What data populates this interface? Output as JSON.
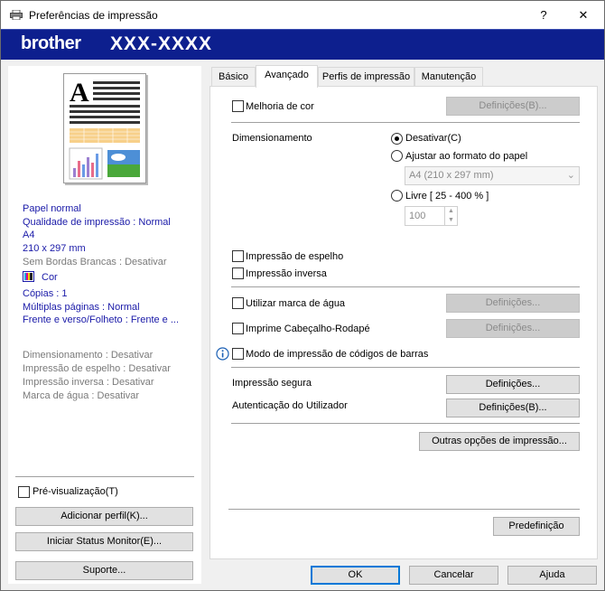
{
  "window": {
    "title": "Preferências de impressão",
    "help": "?",
    "close": "✕"
  },
  "banner": {
    "brand": "brother",
    "model": "XXX-XXXX",
    "color": "#0d1f8e"
  },
  "left": {
    "summary": [
      "Papel normal",
      "Qualidade de impressão : Normal",
      "A4",
      "210 x 297 mm",
      "Sem Bordas Brancas : Desativar",
      "Cor",
      "Cópias : 1",
      "Múltiplas páginas : Normal",
      "Frente e verso/Folheto : Frente e ..."
    ],
    "summary2": [
      "Dimensionamento : Desativar",
      "Impressão de espelho : Desativar",
      "Impressão inversa : Desativar",
      "Marca de água : Desativar"
    ],
    "preview_label": "Pré-visualização(T)",
    "add_profile": "Adicionar perfil(K)...",
    "status_monitor": "Iniciar Status Monitor(E)...",
    "support": "Suporte..."
  },
  "tabs": [
    "Básico",
    "Avançado",
    "Perfis de impressão",
    "Manutenção"
  ],
  "advanced": {
    "color_enhance": "Melhoria de cor",
    "settings_b": "Definições(B)...",
    "scaling_label": "Dimensionamento",
    "opt_off": "Desativar(C)",
    "opt_fit": "Ajustar ao formato do papel",
    "paper_size": "A4 (210 x 297 mm)",
    "opt_free": "Livre [ 25 - 400 % ]",
    "free_value": "100",
    "mirror": "Impressão de espelho",
    "reverse": "Impressão inversa",
    "watermark": "Utilizar marca de água",
    "settings": "Definições...",
    "header_footer": "Imprime Cabeçalho-Rodapé",
    "barcode": "Modo de impressão de códigos de barras",
    "secure": "Impressão segura",
    "user_auth": "Autenticação do Utilizador",
    "other_options": "Outras opções de impressão...",
    "default": "Predefinição"
  },
  "footer": {
    "ok": "OK",
    "cancel": "Cancelar",
    "help": "Ajuda"
  }
}
